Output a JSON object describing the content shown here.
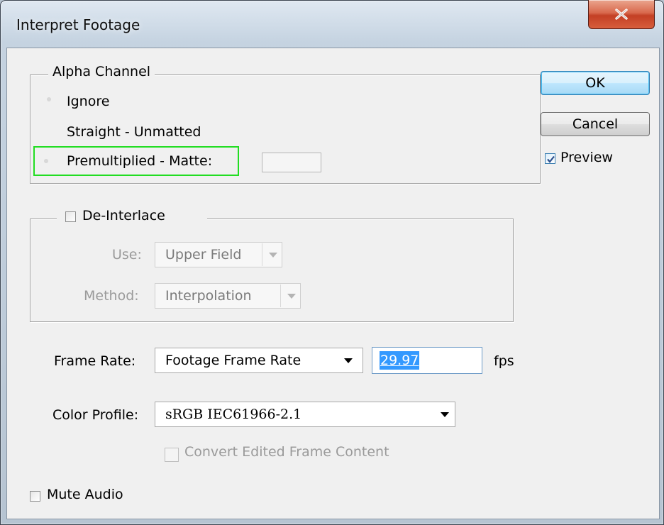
{
  "window": {
    "title": "Interpret Footage"
  },
  "alpha_channel": {
    "legend": "Alpha Channel",
    "options": [
      "Ignore",
      "Straight - Unmatted",
      "Premultiplied - Matte:"
    ]
  },
  "deinterlace": {
    "label": "De-Interlace",
    "checked": false,
    "use_label": "Use:",
    "use_value": "Upper Field",
    "method_label": "Method:",
    "method_value": "Interpolation"
  },
  "frame_rate": {
    "label": "Frame Rate:",
    "value": "Footage Frame Rate",
    "fps_value": "29.97",
    "unit": "fps"
  },
  "color_profile": {
    "label": "Color Profile:",
    "value": "sRGB IEC61966-2.1",
    "convert_label": "Convert Edited Frame Content"
  },
  "mute_audio": {
    "label": "Mute Audio",
    "checked": false
  },
  "buttons": {
    "ok": "OK",
    "cancel": "Cancel"
  },
  "preview": {
    "label": "Preview",
    "checked": true
  },
  "colors": {
    "highlight_box": "#22dd22",
    "selection": "#3399ff",
    "default_button_border": "#3c7fb1"
  }
}
